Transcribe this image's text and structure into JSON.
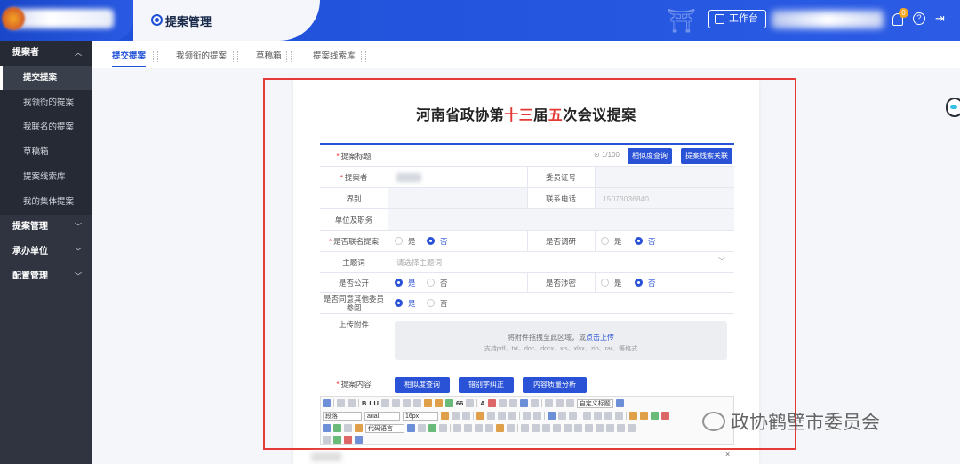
{
  "header": {
    "title": "提案管理",
    "workbench_label": "工作台",
    "notification_count": "0"
  },
  "sidebar": {
    "groups": [
      {
        "label": "提案者",
        "items": [
          {
            "label": "提交提案"
          },
          {
            "label": "我领衔的提案"
          },
          {
            "label": "我联名的提案"
          },
          {
            "label": "草稿箱"
          },
          {
            "label": "提案线索库"
          },
          {
            "label": "我的集体提案"
          }
        ]
      },
      {
        "label": "提案管理"
      },
      {
        "label": "承办单位"
      },
      {
        "label": "配置管理"
      }
    ]
  },
  "tabs": [
    {
      "label": "提交提案"
    },
    {
      "label": "我领衔的提案"
    },
    {
      "label": "草稿箱"
    },
    {
      "label": "提案线索库"
    }
  ],
  "form": {
    "title_part1": "河南省政协第",
    "title_part2": "十三",
    "title_part3": "届",
    "title_part4": "五",
    "title_part5": "次会议提案",
    "proposal_title_label": "提案标题",
    "title_counter": "1/100",
    "similar_query_label": "相似度查询",
    "clue_link_label": "提案线索关联",
    "proposer_label": "提案者",
    "member_id_label": "委员证号",
    "sector_label": "界别",
    "phone_label": "联系电话",
    "phone_value": "15073036840",
    "unit_label": "单位及职务",
    "joint_label": "是否联名提案",
    "research_label": "是否调研",
    "yes": "是",
    "no": "否",
    "topic_label": "主题词",
    "topic_placeholder": "请选择主题词",
    "public_label": "是否公开",
    "secret_label": "是否涉密",
    "agree_label": "是否同意其他委员参阅",
    "upload_label": "上传附件",
    "upload_drag": "将附件拖拽至此区域，或",
    "upload_click": "点击上传",
    "upload_formats": "支持pdf、txt、doc、docx、xls、xlsx、zip、rar、等格式",
    "content_label": "提案内容",
    "btn_similar": "相似度查询",
    "btn_typo": "错别字纠正",
    "btn_quality": "内容质量分析"
  },
  "editor": {
    "paragraph_format": "段落",
    "font_family": "arial",
    "font_size": "16px",
    "custom_title": "自定义标题",
    "code_language": "代码语言"
  },
  "watermark": "政协鹤壁市委员会"
}
